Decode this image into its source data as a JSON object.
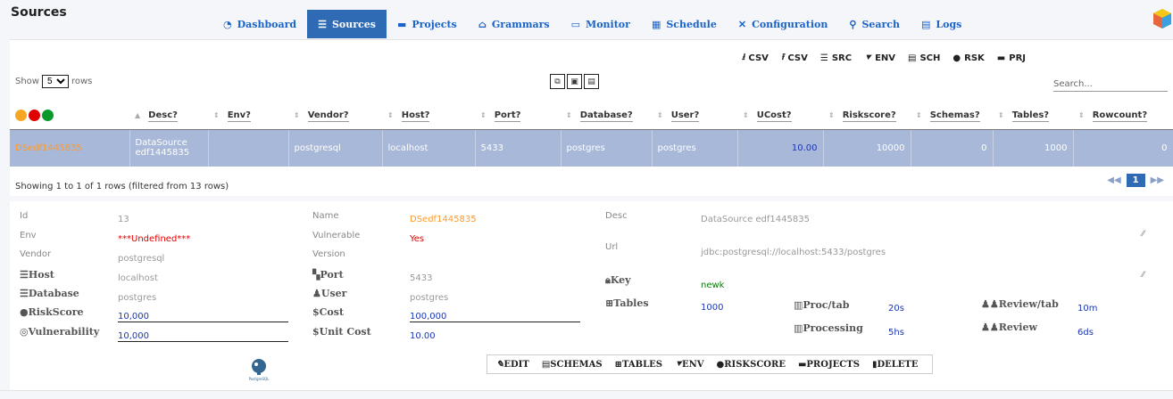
{
  "app": {
    "title": "Sources"
  },
  "nav": [
    {
      "label": "Dashboard",
      "icon": "pie-chart-icon",
      "active": false,
      "glyph": "◔"
    },
    {
      "label": "Sources",
      "icon": "database-icon",
      "active": true,
      "glyph": "☰"
    },
    {
      "label": "Projects",
      "icon": "folder-icon",
      "active": false,
      "glyph": "▬"
    },
    {
      "label": "Grammars",
      "icon": "bank-icon",
      "active": false,
      "glyph": "⌂"
    },
    {
      "label": "Monitor",
      "icon": "monitor-icon",
      "active": false,
      "glyph": "▭"
    },
    {
      "label": "Schedule",
      "icon": "calendar-icon",
      "active": false,
      "glyph": "▦"
    },
    {
      "label": "Configuration",
      "icon": "tools-icon",
      "active": false,
      "glyph": "✕"
    },
    {
      "label": "Search",
      "icon": "search-icon",
      "active": false,
      "glyph": "⚲"
    },
    {
      "label": "Logs",
      "icon": "file-icon",
      "active": false,
      "glyph": "▤"
    }
  ],
  "exports": [
    {
      "label": "CSV",
      "glyph": "⭳"
    },
    {
      "label": "CSV",
      "glyph": "⭱"
    },
    {
      "label": "SRC",
      "glyph": "☰"
    },
    {
      "label": "ENV",
      "glyph": "⯆"
    },
    {
      "label": "SCH",
      "glyph": "▤"
    },
    {
      "label": "RSK",
      "glyph": "●"
    },
    {
      "label": "PRJ",
      "glyph": "▬"
    }
  ],
  "table_controls": {
    "show_label": "Show",
    "rows_label": "rows",
    "rows_value": "5",
    "search_placeholder": "Search..."
  },
  "status_dot_colors": [
    "#f5a623",
    "#e00000",
    "#0a9a2a"
  ],
  "columns": [
    {
      "label": "Desc?",
      "arrow": "▲"
    },
    {
      "label": "Env?",
      "arrow": "⇕"
    },
    {
      "label": "Vendor?",
      "arrow": "⇕"
    },
    {
      "label": "Host?",
      "arrow": "⇕"
    },
    {
      "label": "Port?",
      "arrow": "⇕"
    },
    {
      "label": "Database?",
      "arrow": "⇕"
    },
    {
      "label": "User?",
      "arrow": "⇕"
    },
    {
      "label": "UCost?",
      "arrow": "⇕"
    },
    {
      "label": "Riskscore?",
      "arrow": "⇕"
    },
    {
      "label": "Schemas?",
      "arrow": "⇕"
    },
    {
      "label": "Tables?",
      "arrow": "⇕"
    },
    {
      "label": "Rowcount?",
      "arrow": "⇕"
    }
  ],
  "row": {
    "name": "DSedf1445835",
    "desc": "DataSource edf1445835",
    "env": "",
    "vendor": "postgresql",
    "host": "localhost",
    "port": "5433",
    "database": "postgres",
    "user": "postgres",
    "ucost": "10.00",
    "riskscore": "10000",
    "schemas": "0",
    "tables": "1000",
    "rowcount": "0"
  },
  "footer": {
    "info": "Showing 1 to 1 of 1 rows (filtered from 13 rows)",
    "prev": "◀◀",
    "page": "1",
    "next": "▶▶"
  },
  "detail": {
    "id_label": "Id",
    "id_value": "13",
    "env_label": "Env",
    "env_value": "***Undefined***",
    "vendor_label": "Vendor",
    "vendor_value": "postgresql",
    "host_label": "Host",
    "host_value": "localhost",
    "database_label": "Database",
    "database_value": "postgres",
    "riskscore_label": "RiskScore",
    "riskscore_value": "10,000",
    "vulnerability_label": "Vulnerability",
    "vulnerability_value": "10,000",
    "name_label": "Name",
    "name_value": "DSedf1445835",
    "vulnerable_label": "Vulnerable",
    "vulnerable_value": "Yes",
    "version_label": "Version",
    "version_value": "",
    "port_label": "Port",
    "port_value": "5433",
    "user_label": "User",
    "user_value": "postgres",
    "cost_label": "Cost",
    "cost_value": "100,000",
    "unitcost_label": "Unit Cost",
    "unitcost_value": "10.00",
    "desc_label": "Desc",
    "desc_value": "DataSource edf1445835",
    "url_label": "Url",
    "url_value": "jdbc:postgresql://localhost:5433/postgres",
    "key_label": "Key",
    "key_value": "newk",
    "tables_label": "Tables",
    "tables_value": "1000",
    "proctab_label": "Proc/tab",
    "proctab_value": "20s",
    "processing_label": "Processing",
    "processing_value": "5hs",
    "reviewtab_label": "Review/tab",
    "reviewtab_value": "10m",
    "review_label": "Review",
    "review_value": "6ds"
  },
  "actions": [
    {
      "label": "EDIT",
      "glyph": "✎"
    },
    {
      "label": "SCHEMAS",
      "glyph": "▤"
    },
    {
      "label": "TABLES",
      "glyph": "⊞"
    },
    {
      "label": "ENV",
      "glyph": "⯆"
    },
    {
      "label": "RISKSCORE",
      "glyph": "●"
    },
    {
      "label": "PROJECTS",
      "glyph": "▬"
    },
    {
      "label": "DELETE",
      "glyph": "▮"
    }
  ],
  "vendor_logo_text": "PostgreSQL"
}
